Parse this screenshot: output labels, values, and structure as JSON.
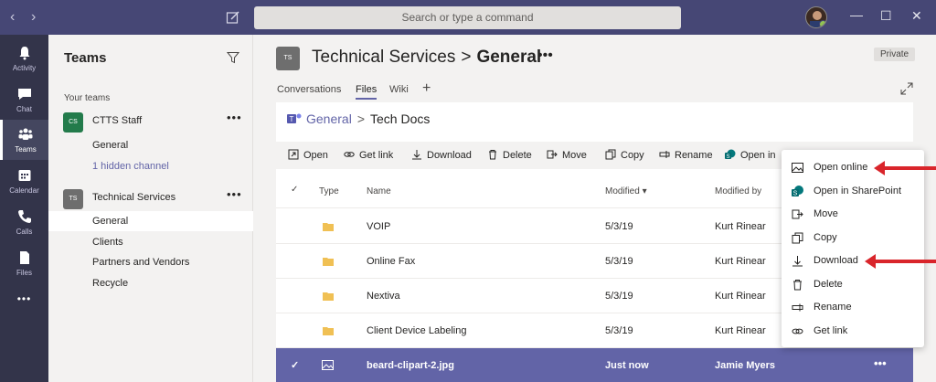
{
  "titlebar": {
    "search_placeholder": "Search or type a command"
  },
  "appbar": {
    "items": [
      {
        "label": "Activity",
        "icon": "bell-icon"
      },
      {
        "label": "Chat",
        "icon": "chat-icon"
      },
      {
        "label": "Teams",
        "icon": "teams-icon"
      },
      {
        "label": "Calendar",
        "icon": "calendar-icon"
      },
      {
        "label": "Calls",
        "icon": "phone-icon"
      },
      {
        "label": "Files",
        "icon": "file-icon"
      }
    ],
    "more": "•••"
  },
  "left_panel": {
    "title": "Teams",
    "section": "Your teams",
    "teams": [
      {
        "initials": "CS",
        "name": "CTTS Staff",
        "color": "#237b4b",
        "channels": [
          "General",
          "1 hidden channel"
        ]
      },
      {
        "initials": "TS",
        "name": "Technical Services",
        "color": "#6e6e6e",
        "channels": [
          "General",
          "Clients",
          "Partners and Vendors",
          "Recycle"
        ]
      }
    ],
    "more": "•••"
  },
  "header": {
    "tile": "TS",
    "team": "Technical Services",
    "separator": ">",
    "channel": "General",
    "more": "•••",
    "private": "Private",
    "tabs": [
      "Conversations",
      "Files",
      "Wiki"
    ],
    "add_tab": "+"
  },
  "files": {
    "breadcrumb": {
      "root": "General",
      "sep": ">",
      "current": "Tech Docs"
    },
    "toolbar": [
      "Open",
      "Get link",
      "Download",
      "Delete",
      "Move",
      "Copy",
      "Rename",
      "Open in"
    ],
    "columns": {
      "type": "Type",
      "name": "Name",
      "modified": "Modified ▾",
      "modified_by": "Modified by"
    },
    "rows": [
      {
        "name": "VOIP",
        "modified": "5/3/19",
        "by": "Kurt Rinear"
      },
      {
        "name": "Online Fax",
        "modified": "5/3/19",
        "by": "Kurt Rinear"
      },
      {
        "name": "Nextiva",
        "modified": "5/3/19",
        "by": "Kurt Rinear"
      },
      {
        "name": "Client Device Labeling",
        "modified": "5/3/19",
        "by": "Kurt Rinear"
      }
    ],
    "selected_row": {
      "name": "beard-clipart-2.jpg",
      "modified": "Just now",
      "by": "Jamie Myers",
      "more": "•••"
    }
  },
  "context_menu": {
    "items": [
      "Open online",
      "Open in SharePoint",
      "Move",
      "Copy",
      "Download",
      "Delete",
      "Rename",
      "Get link"
    ]
  },
  "colors": {
    "titlebar": "#464775",
    "appbar": "#33344a",
    "accent": "#6264a7",
    "arrow": "#d9252b"
  }
}
